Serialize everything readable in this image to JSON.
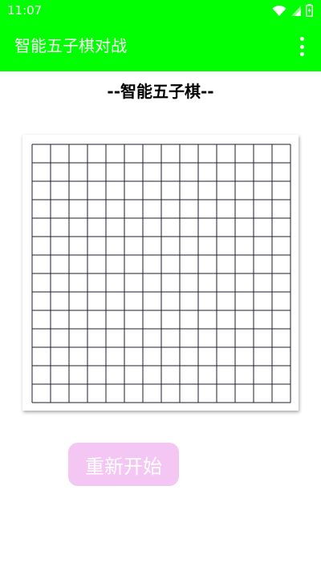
{
  "status_bar": {
    "time": "11:07",
    "icons": [
      "wifi-icon",
      "signal-icon",
      "battery-charging-icon"
    ]
  },
  "app_bar": {
    "title": "智能五子棋对战",
    "menu_icon": "more-vert-icon"
  },
  "main": {
    "heading": "--智能五子棋--",
    "board": {
      "columns": 14,
      "rows": 14,
      "line_color": "#1c1f2e"
    },
    "restart_label": "重新开始"
  },
  "colors": {
    "accent": "#00ff00",
    "button": "#f4c6f4"
  }
}
